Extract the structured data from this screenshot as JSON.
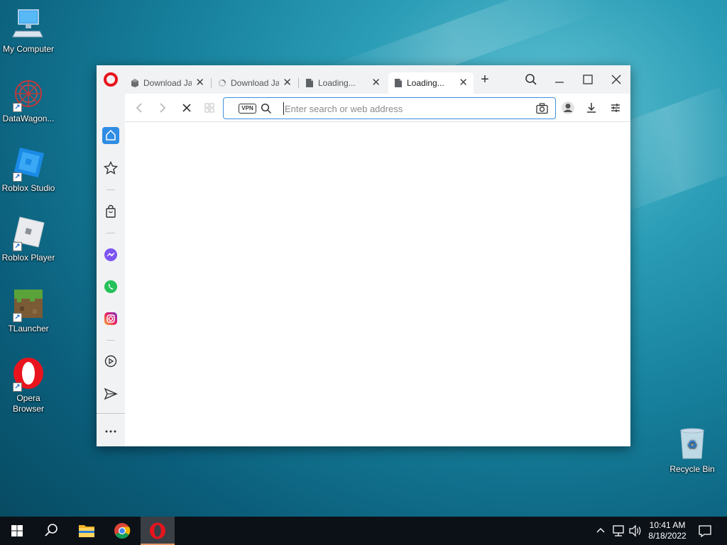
{
  "desktop": {
    "icons": [
      {
        "label": "My Computer",
        "icon": "computer-icon"
      },
      {
        "label": "DataWagon...",
        "icon": "datawagon-icon"
      },
      {
        "label": "Roblox Studio",
        "icon": "roblox-studio-icon"
      },
      {
        "label": "Roblox Player",
        "icon": "roblox-player-icon"
      },
      {
        "label": "TLauncher",
        "icon": "tlauncher-icon"
      },
      {
        "label": "Opera Browser",
        "icon": "opera-icon"
      },
      {
        "label": "Recycle Bin",
        "icon": "recycle-bin-icon"
      }
    ]
  },
  "browser": {
    "tabs": [
      {
        "label": "Download Ja",
        "icon": "box-icon",
        "active": false
      },
      {
        "label": "Download Ja",
        "icon": "loading-spinner-icon",
        "active": false
      },
      {
        "label": "Loading...",
        "icon": "page-icon",
        "active": false
      },
      {
        "label": "Loading...",
        "icon": "page-icon",
        "active": true
      }
    ],
    "address_bar": {
      "placeholder": "Enter search or web address",
      "value": "",
      "vpn_label": "VPN"
    },
    "sidebar": [
      "home",
      "bookmarks",
      "shopping",
      "messenger",
      "whatsapp",
      "instagram",
      "player",
      "send",
      "more"
    ]
  },
  "taskbar": {
    "time": "10:41 AM",
    "date": "8/18/2022",
    "pinned": [
      "file-explorer",
      "chrome",
      "opera"
    ],
    "active_app": "opera"
  },
  "colors": {
    "accent": "#3e8fd9",
    "opera_red": "#e8141d",
    "taskbar": "#0c1118"
  }
}
